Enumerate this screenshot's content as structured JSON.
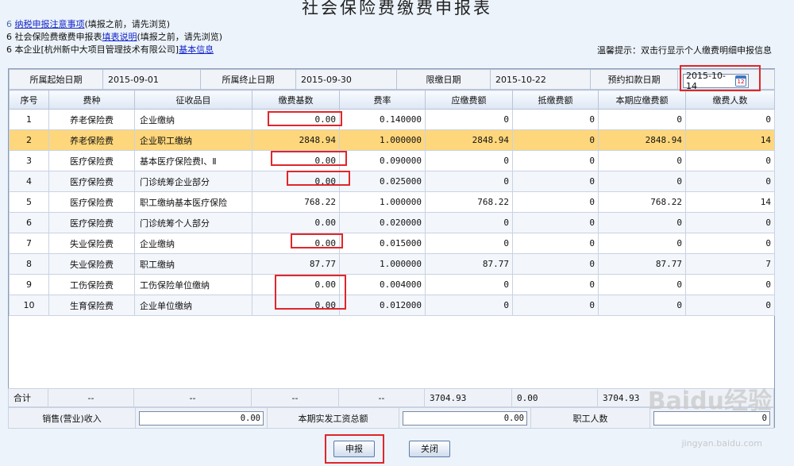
{
  "title": "社会保险费缴费申报表",
  "notes": [
    {
      "prefix": "6 ",
      "link": "纳税申报注意事项",
      "suffix": "(填报之前，请先浏览)"
    },
    {
      "prefix": "6 社会保险费缴费申报表",
      "link": "填表说明",
      "suffix": "(填报之前，请先浏览)"
    },
    {
      "prefix": "6 本企业[杭州新中大项目管理技术有限公司]",
      "link": "基本信息",
      "suffix": ""
    }
  ],
  "hint": "温馨提示：双击行显示个人缴费明细申报信息",
  "info": {
    "start_label": "所属起始日期",
    "start_value": "2015-09-01",
    "end_label": "所属终止日期",
    "end_value": "2015-09-30",
    "limit_label": "限缴日期",
    "limit_value": "2015-10-22",
    "deduct_label": "预约扣款日期",
    "deduct_value": "2015-10-14"
  },
  "columns": [
    "序号",
    "费种",
    "征收品目",
    "缴费基数",
    "费率",
    "应缴费额",
    "抵缴费额",
    "本期应缴费额",
    "缴费人数"
  ],
  "rows": [
    [
      "1",
      "养老保险费",
      "企业缴纳",
      "0.00",
      "0.140000",
      "0",
      "0",
      "0",
      "0"
    ],
    [
      "2",
      "养老保险费",
      "企业职工缴纳",
      "2848.94",
      "1.000000",
      "2848.94",
      "0",
      "2848.94",
      "14"
    ],
    [
      "3",
      "医疗保险费",
      "基本医疗保险费Ⅰ、Ⅱ",
      "0.00",
      "0.090000",
      "0",
      "0",
      "0",
      "0"
    ],
    [
      "4",
      "医疗保险费",
      "门诊统筹企业部分",
      "0.00",
      "0.025000",
      "0",
      "0",
      "0",
      "0"
    ],
    [
      "5",
      "医疗保险费",
      "职工缴纳基本医疗保险",
      "768.22",
      "1.000000",
      "768.22",
      "0",
      "768.22",
      "14"
    ],
    [
      "6",
      "医疗保险费",
      "门诊统筹个人部分",
      "0.00",
      "0.020000",
      "0",
      "0",
      "0",
      "0"
    ],
    [
      "7",
      "失业保险费",
      "企业缴纳",
      "0.00",
      "0.015000",
      "0",
      "0",
      "0",
      "0"
    ],
    [
      "8",
      "失业保险费",
      "职工缴纳",
      "87.77",
      "1.000000",
      "87.77",
      "0",
      "87.77",
      "7"
    ],
    [
      "9",
      "工伤保险费",
      "工伤保险单位缴纳",
      "0.00",
      "0.004000",
      "0",
      "0",
      "0",
      "0"
    ],
    [
      "10",
      "生育保险费",
      "企业单位缴纳",
      "0.00",
      "0.012000",
      "0",
      "0",
      "0",
      "0"
    ]
  ],
  "selected_row": 2,
  "totals": [
    "合计",
    "--",
    "--",
    "--",
    "--",
    "3704.93",
    "0.00",
    "3704.93",
    ""
  ],
  "extra": {
    "sales_label": "销售(营业)收入",
    "sales_value": "0.00",
    "wage_label": "本期实发工资总额",
    "wage_value": "0.00",
    "staff_label": "职工人数",
    "staff_value": "0"
  },
  "buttons": {
    "submit": "申报",
    "close": "关闭"
  },
  "watermark": {
    "brand": "Baidu经验",
    "url": "jingyan.baidu.com"
  },
  "colors": {
    "selected_row": "#fed77c",
    "highlight_box": "#e0262b",
    "link": "#1426c8"
  }
}
